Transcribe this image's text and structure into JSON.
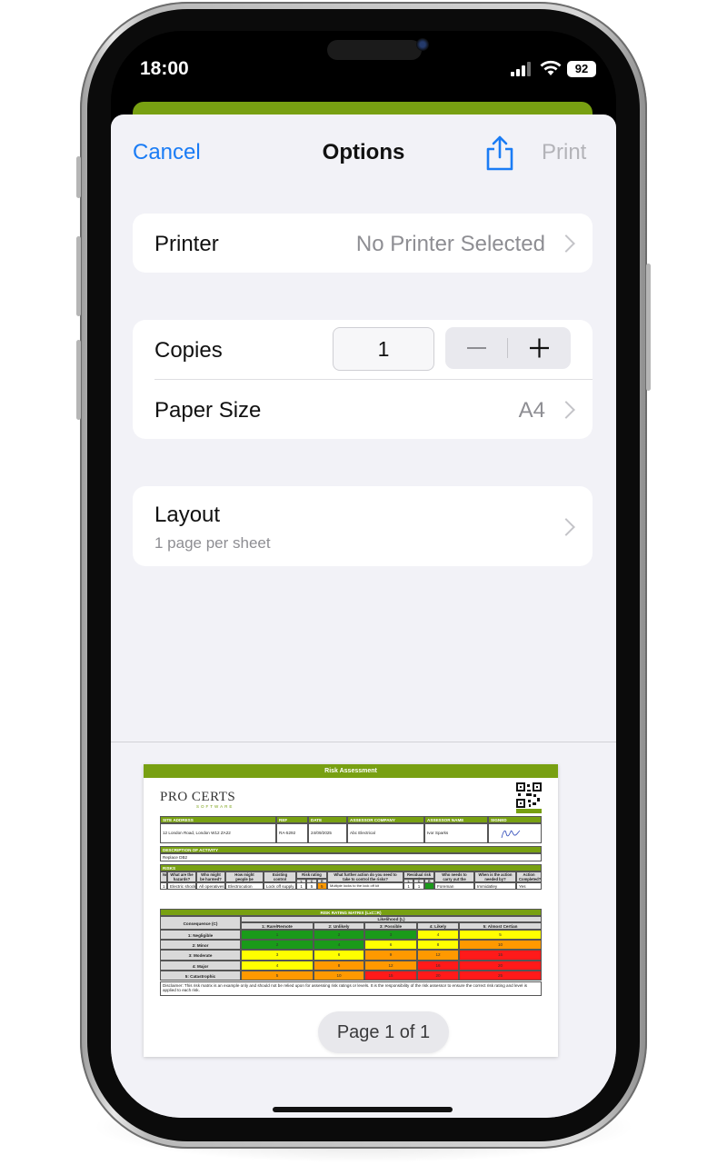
{
  "status_bar": {
    "time": "18:00",
    "battery": "92"
  },
  "nav": {
    "cancel": "Cancel",
    "title": "Options",
    "print": "Print",
    "share_icon": "share-icon"
  },
  "printer": {
    "label": "Printer",
    "value": "No Printer Selected"
  },
  "copies": {
    "label": "Copies",
    "value": "1",
    "minus": "—",
    "plus": "+"
  },
  "paper_size": {
    "label": "Paper Size",
    "value": "A4"
  },
  "layout": {
    "label": "Layout",
    "subtitle": "1 page per sheet"
  },
  "preview": {
    "page_indicator": "Page 1 of 1",
    "doc_title": "Risk Assessment",
    "logo": "PRO CERTS",
    "logo_sub": "SOFTWARE",
    "headers": {
      "site_address": "SITE ADDRESS",
      "ref": "REF",
      "date": "DATE",
      "assessor_company": "ASSESSOR COMPANY",
      "assessor_name": "ASSESSOR NAME",
      "signed": "SIGNED"
    },
    "values": {
      "site_address": "12 London Road, London W12 ZA22",
      "ref": "RA-5292",
      "date": "24/09/2025",
      "assessor_company": "Abc Electrical",
      "assessor_name": "Ivor Sparks"
    },
    "activity_header": "DESCRIPTION OF ACTIVITY",
    "activity": "Replace DB2",
    "risks_header": "RISKS",
    "risk_cols": [
      "No",
      "What are the hazards?",
      "Who might be harmed?",
      "How might people be harmed?",
      "Existing control measures",
      "Risk rating",
      "What further action do you need to take to control the risks?",
      "Residual risk rating",
      "Who needs to carry out the action?",
      "When is the action needed by?",
      "Action Completed?"
    ],
    "lcr": [
      "L",
      "C",
      "R"
    ],
    "risk_row": [
      "1",
      "Electric shock",
      "All operatives",
      "Electrocution",
      "Lock off supply",
      "1",
      "5",
      "5",
      "Multiple locks to the lock off kit",
      "1",
      "1",
      "",
      "Foreman",
      "Immidatley",
      "Yes"
    ],
    "matrix": {
      "title": "RISK RATING MATRIX (LxC=R)",
      "consequence_label": "Consequence (C)",
      "likelihood_label": "Likelihood (L)",
      "columns": [
        "1: Rare/Remote",
        "2: Unlikely",
        "3: Possible",
        "4: Likely",
        "5: Almost Certian"
      ],
      "rows": [
        {
          "label": "1: Negligible",
          "values": [
            "1",
            "2",
            "3",
            "4",
            "5"
          ]
        },
        {
          "label": "2: Minor",
          "values": [
            "2",
            "4",
            "6",
            "8",
            "10"
          ]
        },
        {
          "label": "3: Moderate",
          "values": [
            "3",
            "6",
            "9",
            "12",
            "15"
          ]
        },
        {
          "label": "4: Major",
          "values": [
            "4",
            "8",
            "12",
            "16",
            "20"
          ]
        },
        {
          "label": "5: Catastrophic",
          "values": [
            "5",
            "10",
            "15",
            "20",
            "25"
          ]
        }
      ]
    },
    "disclaimer": "Disclaimer: This risk matrix is an example only and should not be relied upon for assessing risk ratings or levels. It is the responsibility of the risk assessor to ensure the correct risk rating and level is applied to each risk.",
    "colors": {
      "brand": "#78a012",
      "green": "#1a9a1a",
      "yellow": "#ffff00",
      "orange": "#ff9900",
      "red": "#ff1a1a"
    }
  }
}
